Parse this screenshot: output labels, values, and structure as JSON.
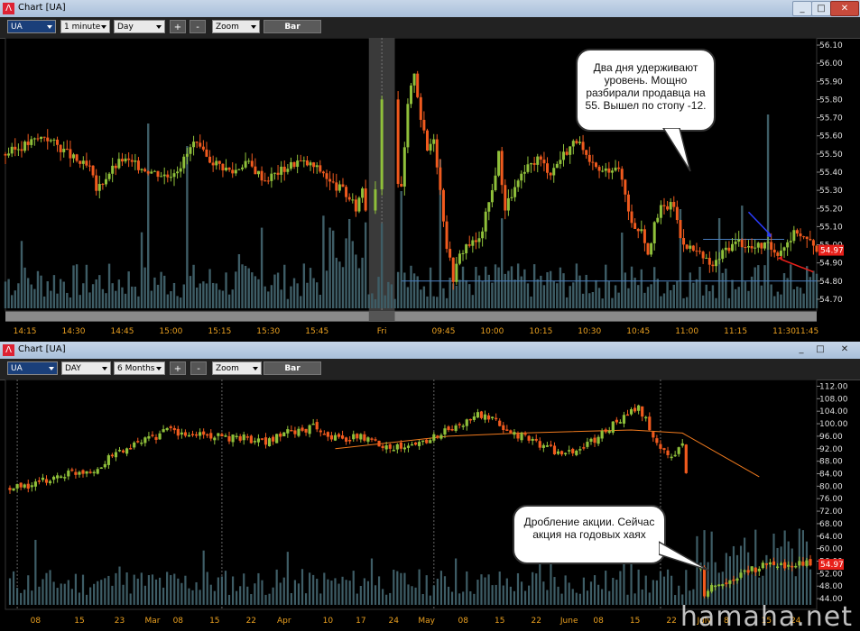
{
  "top_window": {
    "title": "Chart [UA]",
    "symbol": "UA",
    "interval": "1 minute",
    "period": "Day",
    "zoom_plus": "+",
    "zoom_minus": "-",
    "zoom": "Zoom",
    "bar": "Bar",
    "annotation": "Два дня удерживают уровень. Мощно разбирали продавца на 55. Вышел по стопу -12.",
    "last_price": "54.97"
  },
  "bottom_window": {
    "title": "Chart [UA]",
    "symbol": "UA",
    "interval": "DAY",
    "period": "6 Months",
    "zoom_plus": "+",
    "zoom_minus": "-",
    "zoom": "Zoom",
    "bar": "Bar",
    "annotation": "Дробление акции. Сейчас акция на годовых хаях",
    "last_price": "54.97"
  },
  "watermark": "hamaha.net",
  "colors": {
    "up": "#8fc03a",
    "down": "#f05a1e",
    "volume": "#3e5d66",
    "ma": "#f07a1e",
    "level": "#4a7fc0",
    "price_tag": "#e8201a"
  },
  "chart_data": [
    {
      "type": "candlestick",
      "title": "UA 1 minute",
      "ylim": [
        54.65,
        56.12
      ],
      "y_ticks": [
        "56.10",
        "56.00",
        "55.90",
        "55.80",
        "55.70",
        "55.60",
        "55.50",
        "55.40",
        "55.30",
        "55.20",
        "55.10",
        "55.00",
        "54.90",
        "54.80",
        "54.70"
      ],
      "x_ticks": [
        "14:15",
        "14:30",
        "14:45",
        "15:00",
        "15:15",
        "15:30",
        "15:45",
        "Fri",
        "09:45",
        "10:00",
        "10:15",
        "10:30",
        "10:45",
        "11:00",
        "11:15",
        "11:30",
        "11:45"
      ],
      "close_path": [
        [
          0,
          55.5
        ],
        [
          6,
          55.55
        ],
        [
          12,
          55.6
        ],
        [
          18,
          55.52
        ],
        [
          22,
          55.46
        ],
        [
          26,
          55.42
        ],
        [
          28,
          55.3
        ],
        [
          32,
          55.4
        ],
        [
          36,
          55.47
        ],
        [
          40,
          55.44
        ],
        [
          46,
          55.4
        ],
        [
          50,
          55.38
        ],
        [
          54,
          55.44
        ],
        [
          58,
          55.56
        ],
        [
          62,
          55.48
        ],
        [
          66,
          55.44
        ],
        [
          70,
          55.4
        ],
        [
          74,
          55.46
        ],
        [
          80,
          55.36
        ],
        [
          86,
          55.42
        ],
        [
          90,
          55.46
        ],
        [
          94,
          55.44
        ],
        [
          98,
          55.4
        ],
        [
          100,
          55.34
        ],
        [
          104,
          55.3
        ],
        [
          108,
          55.2
        ],
        [
          110,
          55.32
        ],
        [
          112,
          55.1
        ],
        [
          114,
          55.32
        ],
        [
          116,
          55.82
        ],
        [
          118,
          55.86
        ],
        [
          120,
          55.4
        ],
        [
          122,
          55.3
        ],
        [
          124,
          55.76
        ],
        [
          126,
          55.96
        ],
        [
          128,
          55.7
        ],
        [
          130,
          55.52
        ],
        [
          132,
          55.6
        ],
        [
          134,
          55.3
        ],
        [
          136,
          55.0
        ],
        [
          138,
          54.82
        ],
        [
          140,
          54.94
        ],
        [
          142,
          55.0
        ],
        [
          146,
          55.02
        ],
        [
          150,
          55.3
        ],
        [
          152,
          55.5
        ],
        [
          154,
          55.2
        ],
        [
          156,
          55.28
        ],
        [
          160,
          55.4
        ],
        [
          164,
          55.48
        ],
        [
          168,
          55.4
        ],
        [
          172,
          55.5
        ],
        [
          176,
          55.58
        ],
        [
          180,
          55.44
        ],
        [
          184,
          55.4
        ],
        [
          188,
          55.44
        ],
        [
          190,
          55.36
        ],
        [
          192,
          55.2
        ],
        [
          194,
          55.08
        ],
        [
          196,
          55.1
        ],
        [
          198,
          54.96
        ],
        [
          200,
          55.1
        ],
        [
          202,
          55.2
        ],
        [
          206,
          55.22
        ],
        [
          208,
          55.04
        ],
        [
          210,
          55.0
        ],
        [
          214,
          54.94
        ],
        [
          218,
          54.88
        ],
        [
          222,
          54.98
        ],
        [
          226,
          55.02
        ],
        [
          230,
          54.98
        ],
        [
          234,
          55.0
        ],
        [
          238,
          54.96
        ],
        [
          242,
          55.04
        ],
        [
          244,
          55.08
        ],
        [
          246,
          55.04
        ],
        [
          250,
          54.98
        ]
      ],
      "support_level": 55.03,
      "stop_level": 54.8,
      "last": 54.97
    },
    {
      "type": "candlestick",
      "title": "UA DAY 6 Months",
      "ylim": [
        42.0,
        113.0
      ],
      "y_ticks": [
        "112.00",
        "108.00",
        "104.00",
        "100.00",
        "96.00",
        "92.00",
        "88.00",
        "84.00",
        "80.00",
        "76.00",
        "72.00",
        "68.00",
        "64.00",
        "60.00",
        "56.00",
        "52.00",
        "48.00",
        "44.00"
      ],
      "x_ticks": [
        "08",
        "15",
        "23",
        "Mar",
        "08",
        "15",
        "22",
        "Apr",
        "10",
        "17",
        "24",
        "May",
        "08",
        "15",
        "22",
        "June",
        "08",
        "15",
        "22",
        "July",
        "8",
        "15",
        "24"
      ],
      "close_path": [
        [
          0,
          79
        ],
        [
          5,
          80
        ],
        [
          10,
          82
        ],
        [
          15,
          84
        ],
        [
          20,
          85
        ],
        [
          25,
          86
        ],
        [
          28,
          90
        ],
        [
          32,
          92
        ],
        [
          36,
          94
        ],
        [
          40,
          96
        ],
        [
          44,
          98
        ],
        [
          48,
          96
        ],
        [
          52,
          97
        ],
        [
          56,
          96
        ],
        [
          60,
          95
        ],
        [
          64,
          96
        ],
        [
          68,
          94
        ],
        [
          72,
          95
        ],
        [
          76,
          97
        ],
        [
          80,
          98
        ],
        [
          84,
          99
        ],
        [
          88,
          96
        ],
        [
          92,
          95
        ],
        [
          96,
          96
        ],
        [
          100,
          94
        ],
        [
          104,
          93
        ],
        [
          108,
          92
        ],
        [
          112,
          94
        ],
        [
          116,
          96
        ],
        [
          120,
          98
        ],
        [
          124,
          100
        ],
        [
          128,
          103
        ],
        [
          132,
          101
        ],
        [
          136,
          98
        ],
        [
          140,
          96
        ],
        [
          144,
          94
        ],
        [
          148,
          92
        ],
        [
          152,
          90
        ],
        [
          156,
          92
        ],
        [
          160,
          95
        ],
        [
          164,
          99
        ],
        [
          168,
          102
        ],
        [
          170,
          104
        ],
        [
          172,
          105
        ],
        [
          174,
          101
        ],
        [
          176,
          96
        ],
        [
          178,
          92
        ],
        [
          180,
          90
        ],
        [
          182,
          91
        ],
        [
          184,
          93
        ],
        [
          190,
          46
        ],
        [
          195,
          49
        ],
        [
          200,
          52
        ],
        [
          205,
          54
        ],
        [
          210,
          55
        ]
      ],
      "moving_average": [
        [
          89,
          92
        ],
        [
          120,
          96
        ],
        [
          140,
          97
        ],
        [
          170,
          98
        ],
        [
          184,
          97
        ],
        [
          205,
          83
        ]
      ],
      "split_note": "post-split",
      "last": 54.97
    }
  ]
}
